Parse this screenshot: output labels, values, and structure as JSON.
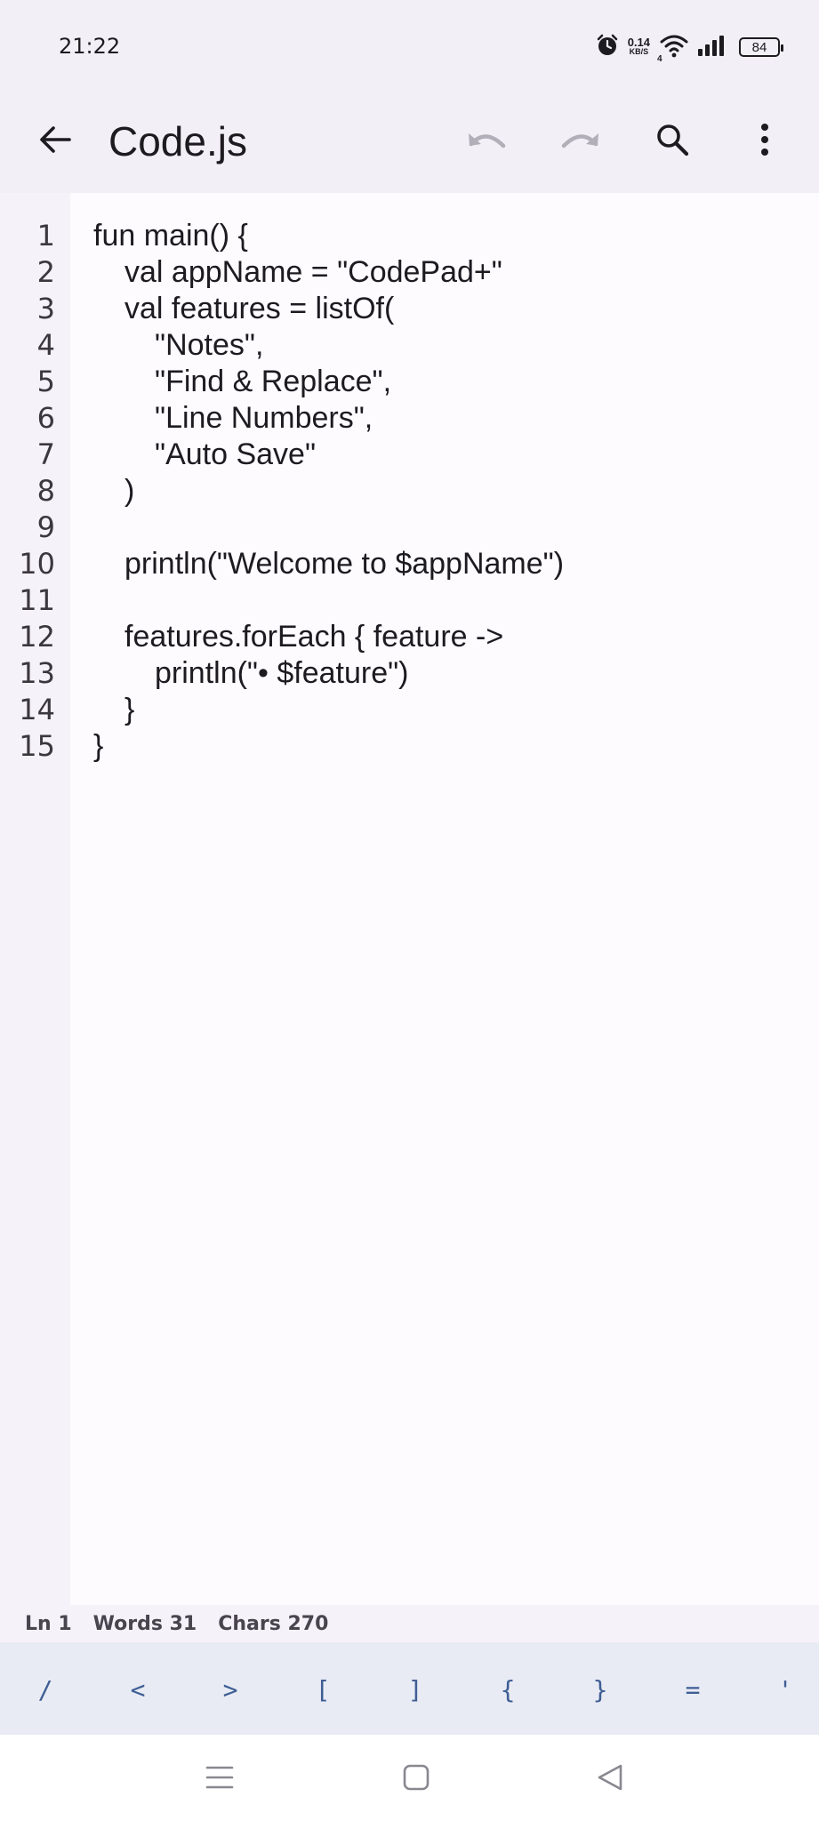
{
  "status_bar": {
    "time": "21:22",
    "net_speed_value": "0.14",
    "net_speed_unit": "KB/S",
    "network_type": "4",
    "battery": "84",
    "icons": [
      "alarm-icon",
      "wifi-icon",
      "signal-icon",
      "battery-icon"
    ]
  },
  "app_bar": {
    "title": "Code.js",
    "icons": [
      "back-arrow-icon",
      "undo-icon",
      "redo-icon",
      "search-icon",
      "more-vert-icon"
    ],
    "disabled_icon_color": "#b3afb9"
  },
  "editor": {
    "line_numbers": [
      "1",
      "2",
      "3",
      "4",
      "5",
      "6",
      "7",
      "8",
      "9",
      "10",
      "11",
      "12",
      "13",
      "14",
      "15"
    ],
    "lines": [
      {
        "text": "fun main() {",
        "indent": 0
      },
      {
        "text": "val appName = \"CodePad+\"",
        "indent": 1
      },
      {
        "text": "val features = listOf(",
        "indent": 1
      },
      {
        "text": "\"Notes\",",
        "indent": 2
      },
      {
        "text": "\"Find & Replace\",",
        "indent": 2
      },
      {
        "text": "\"Line Numbers\",",
        "indent": 2
      },
      {
        "text": "\"Auto Save\"",
        "indent": 2
      },
      {
        "text": ")",
        "indent": 1
      },
      {
        "text": "",
        "indent": 0
      },
      {
        "text": "println(\"Welcome to $appName\")",
        "indent": 1
      },
      {
        "text": "",
        "indent": 0
      },
      {
        "text": "features.forEach { feature ->",
        "indent": 1
      },
      {
        "text": "println(\"• $feature\")",
        "indent": 2
      },
      {
        "text": "}",
        "indent": 1
      },
      {
        "text": "}",
        "indent": 0
      }
    ]
  },
  "stats": {
    "line": "Ln 1",
    "words": "Words 31",
    "chars": "Chars 270"
  },
  "symbol_bar": {
    "keys": [
      "/",
      "<",
      ">",
      "[",
      "]",
      "{",
      "}",
      "=",
      "'"
    ],
    "key_color": "#3f5e94"
  },
  "nav_bar": {
    "icons": [
      "menu-icon",
      "home-square-icon",
      "back-triangle-icon"
    ]
  }
}
